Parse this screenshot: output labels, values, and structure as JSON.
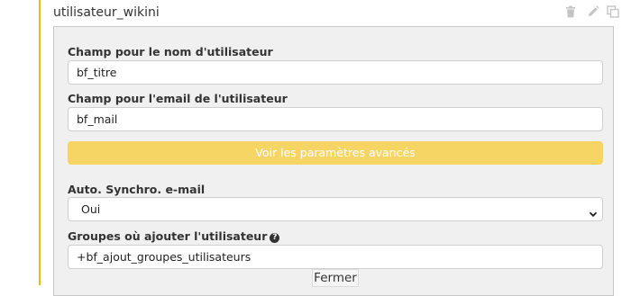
{
  "block": {
    "title": "utilisateur_wikini",
    "accent_color": "#f5b800",
    "actions": [
      {
        "icon": "trash-icon"
      },
      {
        "icon": "pencil-icon"
      },
      {
        "icon": "copy-icon"
      }
    ]
  },
  "form": {
    "username_field": {
      "label": "Champ pour le nom d'utilisateur",
      "value": "bf_titre"
    },
    "email_field": {
      "label": "Champ pour l'email de l'utilisateur",
      "value": "bf_mail"
    },
    "advanced_button": {
      "label": "Voir les paramètres avancés",
      "color": "#f7d565"
    },
    "auto_sync": {
      "label": "Auto. Synchro. e-mail",
      "selected": "Oui"
    },
    "groups_field": {
      "label": "Groupes où ajouter l'utilisateur",
      "help_icon": "question-circle-icon",
      "value": "+bf_ajout_groupes_utilisateurs"
    },
    "close_button": {
      "label": "Fermer"
    }
  }
}
